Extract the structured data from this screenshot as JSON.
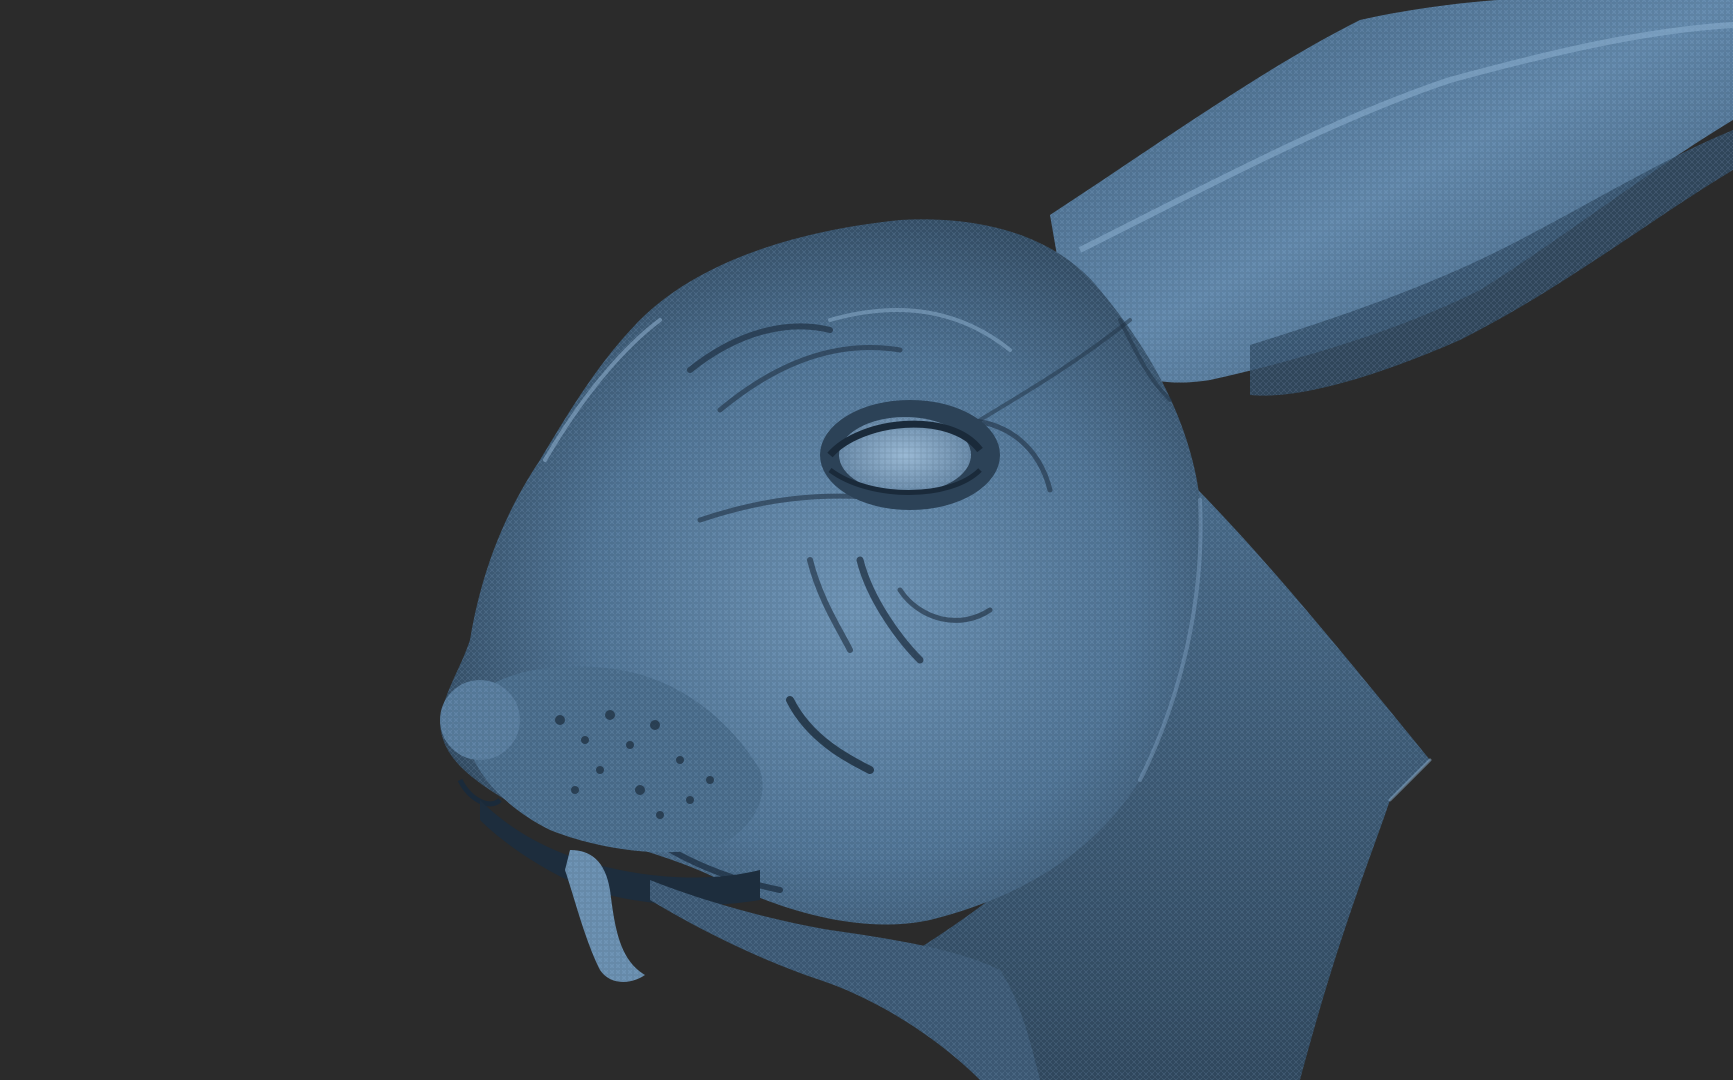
{
  "viewport": {
    "background_color": "#2b2b2b",
    "model_color": "#4f7394",
    "highlight_color": "#8fb3d3",
    "shadow_color": "#1c2a37",
    "subject": "rabbit-head-sculpt"
  }
}
